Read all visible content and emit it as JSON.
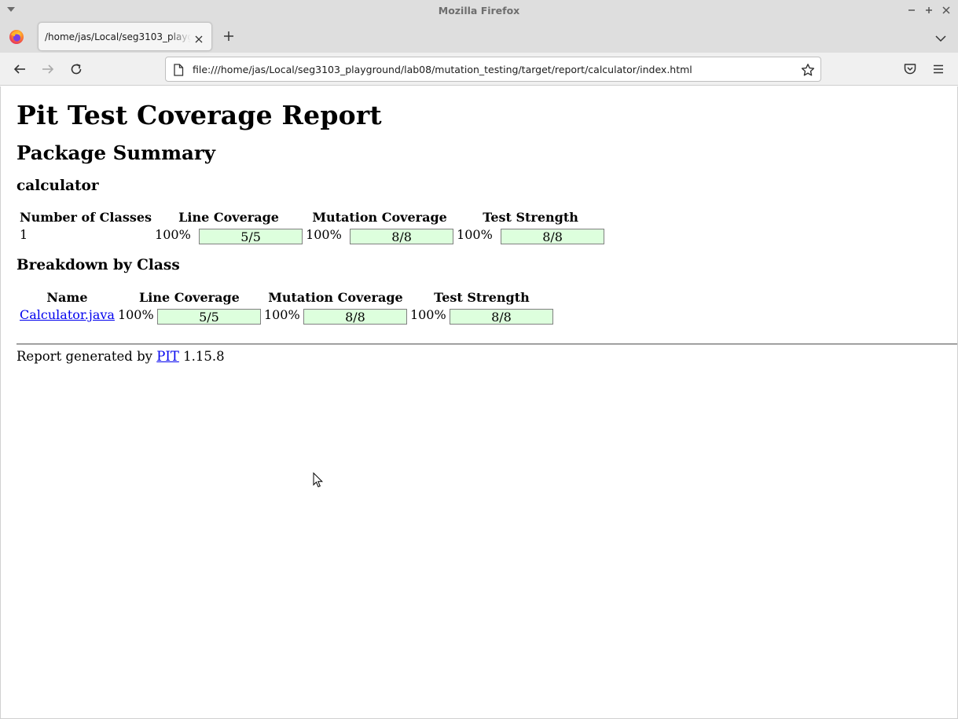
{
  "window": {
    "title": "Mozilla Firefox"
  },
  "tabs": [
    {
      "title": "/home/jas/Local/seg3103_playground/lab08/mutation_testing/target/report/calculator/index.html",
      "active": true
    }
  ],
  "navbar": {
    "url": "file:///home/jas/Local/seg3103_playground/lab08/mutation_testing/target/report/calculator/index.html"
  },
  "icons": {
    "window_menu": "chevron-down-icon",
    "minimize": "minimize-icon",
    "maximize": "maximize-icon",
    "close": "close-icon",
    "firefox": "firefox-logo-icon",
    "tab_close": "close-icon",
    "new_tab": "plus-icon",
    "tab_list": "chevron-down-icon",
    "back": "arrow-left-icon",
    "forward": "arrow-right-icon",
    "reload": "reload-icon",
    "page": "page-icon",
    "bookmark": "star-icon",
    "pocket": "pocket-icon",
    "menu": "hamburger-icon"
  },
  "report": {
    "title": "Pit Test Coverage Report",
    "package_summary_heading": "Package Summary",
    "package_name": "calculator",
    "summary_table": {
      "headers": [
        "Number of Classes",
        "Line Coverage",
        "Mutation Coverage",
        "Test Strength"
      ],
      "row": {
        "classes": "1",
        "line_pct": "100%",
        "line_ratio": "5/5",
        "mutation_pct": "100%",
        "mutation_ratio": "8/8",
        "strength_pct": "100%",
        "strength_ratio": "8/8"
      }
    },
    "breakdown_heading": "Breakdown by Class",
    "breakdown_table": {
      "headers": [
        "Name",
        "Line Coverage",
        "Mutation Coverage",
        "Test Strength"
      ],
      "rows": [
        {
          "name": "Calculator.java",
          "line_pct": "100%",
          "line_ratio": "5/5",
          "mutation_pct": "100%",
          "mutation_ratio": "8/8",
          "strength_pct": "100%",
          "strength_ratio": "8/8"
        }
      ]
    },
    "footer": {
      "prefix": "Report generated by ",
      "link": "PIT",
      "version": " 1.15.8"
    }
  },
  "colors": {
    "coverage_bar": "#ddffdd",
    "link": "#0000ee"
  }
}
